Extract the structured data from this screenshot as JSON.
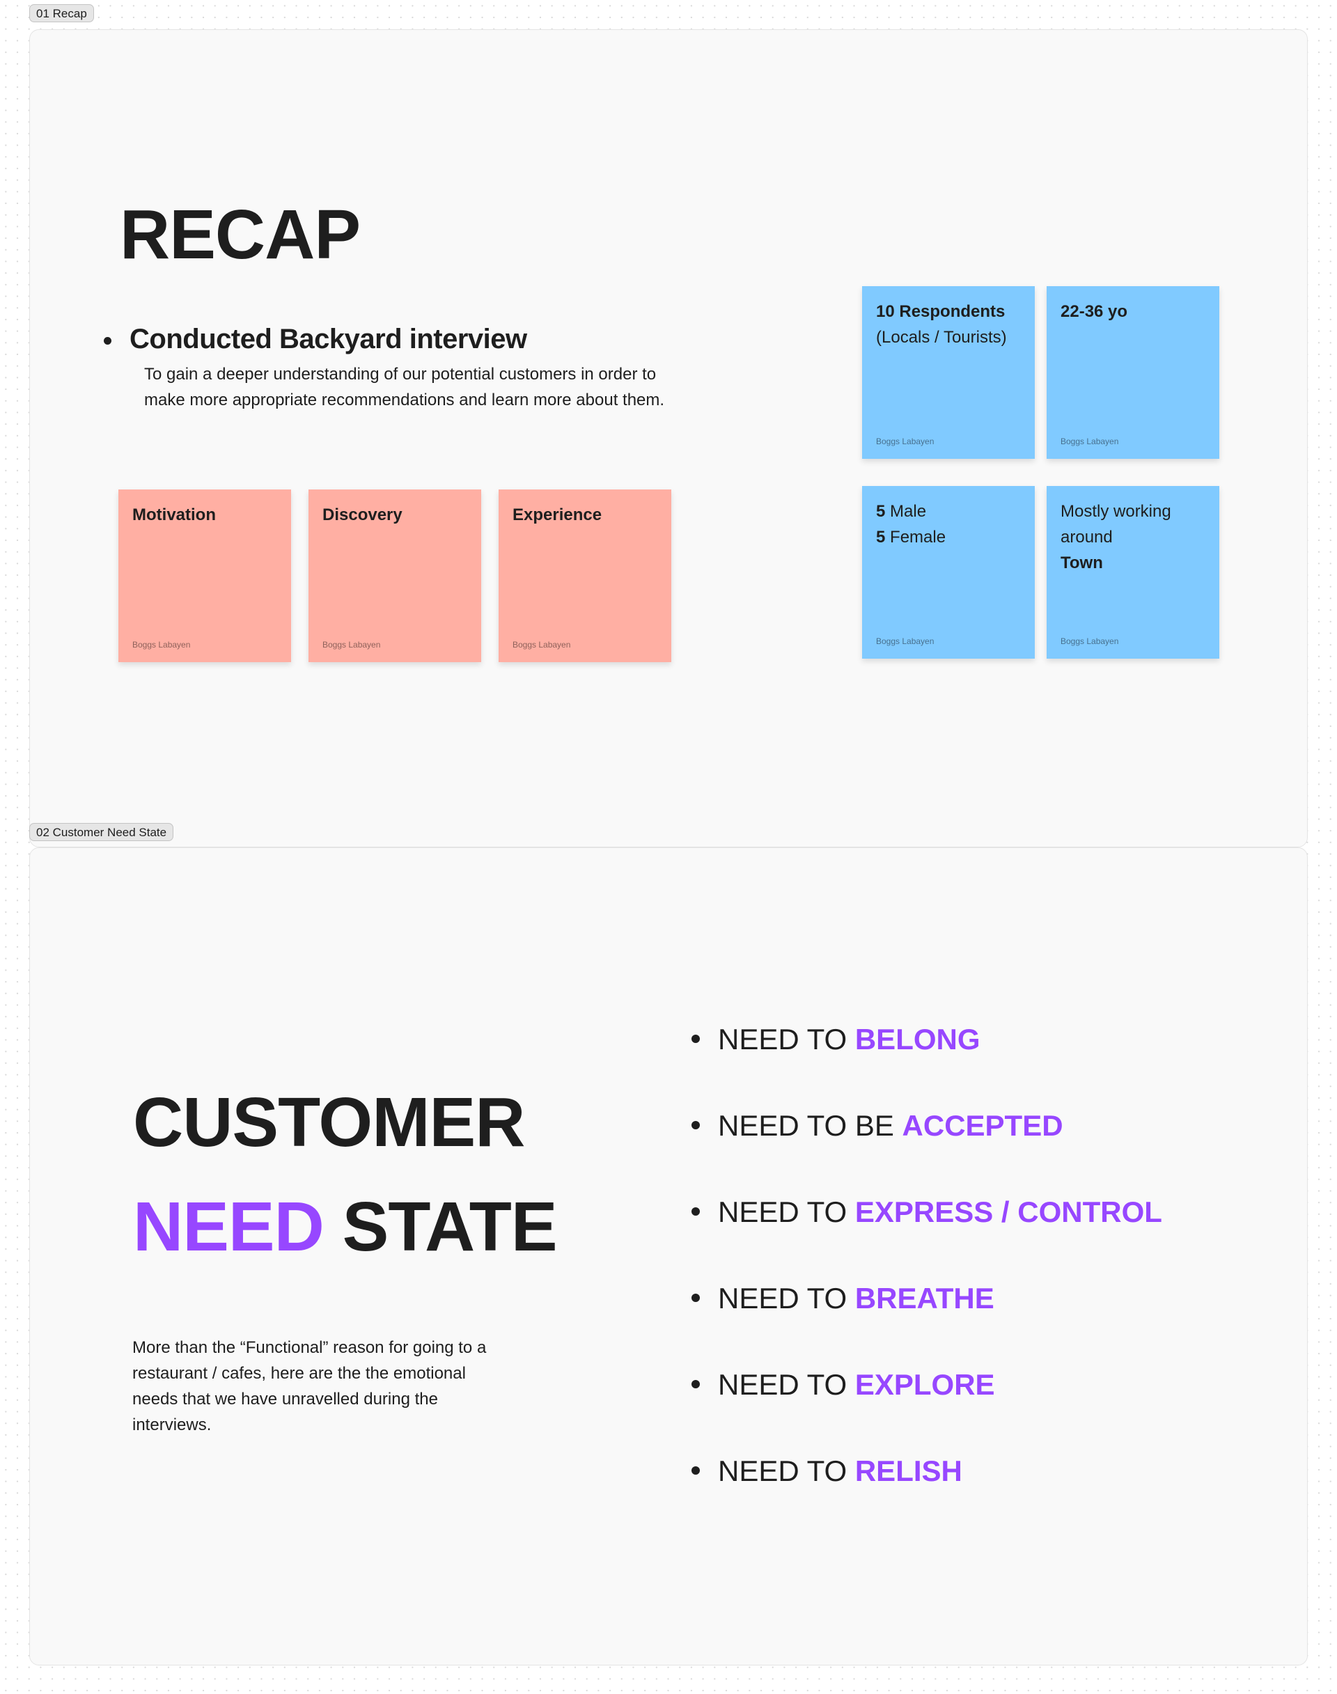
{
  "colors": {
    "accent": "#9747FF",
    "sticky_pink": "#FFAFA3",
    "sticky_blue": "#80CAFF",
    "text": "#1E1E1E"
  },
  "frames": [
    {
      "label": "01 Recap",
      "title": "RECAP",
      "bullet_heading": "Conducted Backyard interview",
      "bullet_body_lines": [
        "To gain a deeper understanding of our potential customers in order to",
        "make more appropriate recommendations and learn more about them."
      ],
      "pink_stickies": [
        {
          "title": "Motivation",
          "author": "Boggs Labayen"
        },
        {
          "title": "Discovery",
          "author": "Boggs Labayen"
        },
        {
          "title": "Experience",
          "author": "Boggs Labayen"
        }
      ],
      "blue_stickies": [
        {
          "line1_bold": "10 Respondents",
          "line2": "(Locals / Tourists)",
          "author": "Boggs Labayen"
        },
        {
          "line1_bold": "22-36 yo",
          "author": "Boggs Labayen"
        },
        {
          "line1_bold_num": "5",
          "line1_rest": " Male",
          "line2_bold_num": "5",
          "line2_rest": " Female",
          "author": "Boggs Labayen"
        },
        {
          "line1": "Mostly working",
          "line2": "around",
          "line3_bold": "Town",
          "author": "Boggs Labayen"
        }
      ]
    },
    {
      "label": "02 Customer Need State",
      "title_line1": "CUSTOMER",
      "title_line2_accent": "NEED",
      "title_line2_rest": "STATE",
      "description_lines": [
        "More than the “Functional” reason for going to a",
        "restaurant / cafes, here are the the emotional",
        "needs that we have unravelled during the",
        "interviews."
      ],
      "needs": [
        {
          "prefix": "NEED TO ",
          "accent": "BELONG"
        },
        {
          "prefix": "NEED TO BE ",
          "accent": "ACCEPTED"
        },
        {
          "prefix": "NEED TO ",
          "accent": "EXPRESS / CONTROL"
        },
        {
          "prefix": "NEED TO ",
          "accent": "BREATHE"
        },
        {
          "prefix": "NEED TO ",
          "accent": "EXPLORE"
        },
        {
          "prefix": "NEED TO ",
          "accent": "RELISH"
        }
      ]
    }
  ]
}
